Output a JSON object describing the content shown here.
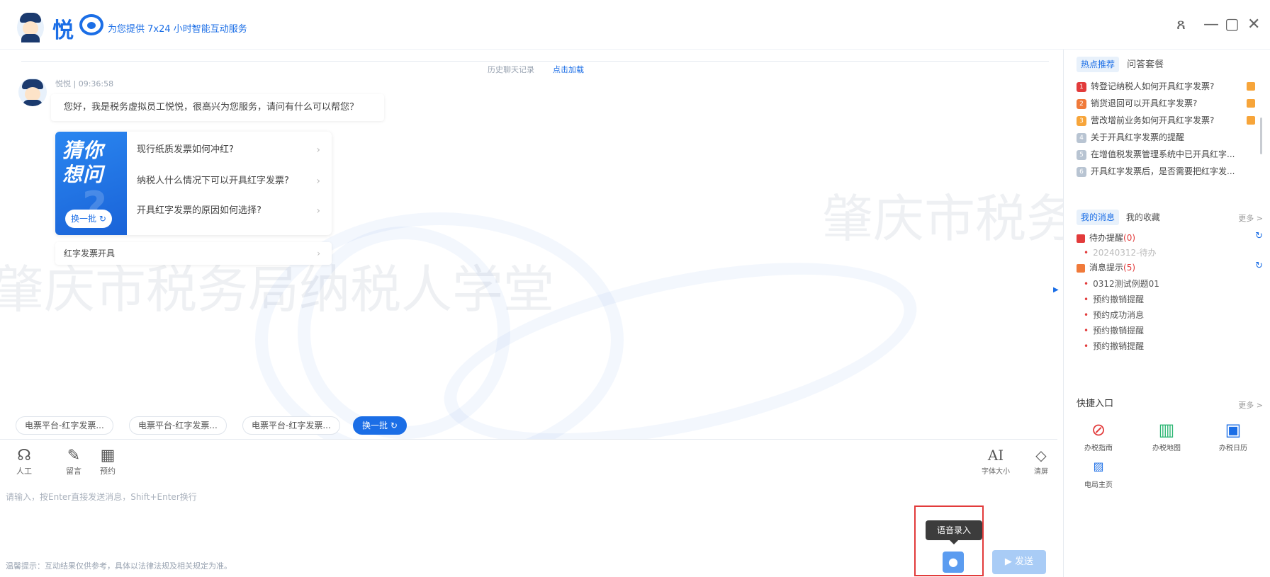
{
  "header": {
    "brand": "悦",
    "tagline": "为您提供 7x24 小时智能互动服务",
    "window_controls": [
      "ጸ",
      "—",
      "▢",
      "✕"
    ]
  },
  "watermarks": [
    "纳税人学堂",
    "肇庆市税务局纳税人学堂",
    "肇庆市税务局纳",
    "肇庆"
  ],
  "chat": {
    "history_text": "历史聊天记录",
    "history_link": "点击加载",
    "bot_meta": "悦悦 | 09:36:58",
    "greeting": "您好，我是税务虚拟员工悦悦，很高兴为您服务，请问有什么可以帮您？",
    "suggest_title": "猜你想问",
    "swap_label": "换一批",
    "suggestions": [
      "现行纸质发票如何冲红?",
      "纳税人什么情况下可以开具红字发票?",
      "开具红字发票的原因如何选择?"
    ],
    "topic": "红字发票开具"
  },
  "chips": [
    "电票平台-红字发票...",
    "电票平台-红字发票...",
    "电票平台-红字发票...",
    "换一批"
  ],
  "input": {
    "tools": [
      {
        "icon": "headset-icon",
        "label": "人工"
      },
      {
        "icon": "edit-icon",
        "label": "留言"
      },
      {
        "icon": "calendar-icon",
        "label": "预约"
      }
    ],
    "right_tools": [
      {
        "icon": "font-size-icon",
        "label": "字体大小"
      },
      {
        "icon": "eraser-icon",
        "label": "清屏"
      }
    ],
    "placeholder": "请输入，按Enter直接发送消息，Shift+Enter换行",
    "tip": "温馨提示：互动结果仅供参考，具体以法律法规及相关规定为准。",
    "voice_tooltip": "语音录入",
    "send_label": "▶ 发送"
  },
  "right_panel": {
    "tabs": [
      "热点推荐",
      "问答套餐"
    ],
    "hot_items": [
      {
        "rank": "1",
        "color": "#e23b3b",
        "text": "转登记纳税人如何开具红字发票?",
        "flag": true
      },
      {
        "rank": "2",
        "color": "#f07a3a",
        "text": "销货退回可以开具红字发票?",
        "flag": true
      },
      {
        "rank": "3",
        "color": "#f7a53a",
        "text": "营改增前业务如何开具红字发票?",
        "flag": true
      },
      {
        "rank": "4",
        "color": "#b8c4d2",
        "text": "关于开具红字发票的提醒",
        "flag": false
      },
      {
        "rank": "5",
        "color": "#b8c4d2",
        "text": "在增值税发票管理系统中已开具红字...",
        "flag": false
      },
      {
        "rank": "6",
        "color": "#b8c4d2",
        "text": "开具红字发票后，是否需要把红字发...",
        "flag": false
      }
    ],
    "msg_tabs": [
      "我的消息",
      "我的收藏"
    ],
    "more_label": "更多 >",
    "todo_label": "待办提醒",
    "todo_count": "(0)",
    "todo_sub": "20240312-待办",
    "notice_label": "消息提示",
    "notice_count": "(5)",
    "notice_items": [
      "0312测试例题01",
      "预约撤销提醒",
      "预约成功消息",
      "预约撤销提醒",
      "预约撤销提醒"
    ],
    "quick_title": "快捷入口",
    "quick_more": "更多 >",
    "quick_items": [
      {
        "icon": "compass-icon",
        "label": "办税指南",
        "color": "#e23b3b"
      },
      {
        "icon": "map-icon",
        "label": "办税地图",
        "color": "#2bb673"
      },
      {
        "icon": "calendar-icon",
        "label": "办税日历",
        "color": "#1b6ee6"
      },
      {
        "icon": "image-icon",
        "label": "电局主页",
        "color": "#1b6ee6"
      }
    ]
  }
}
